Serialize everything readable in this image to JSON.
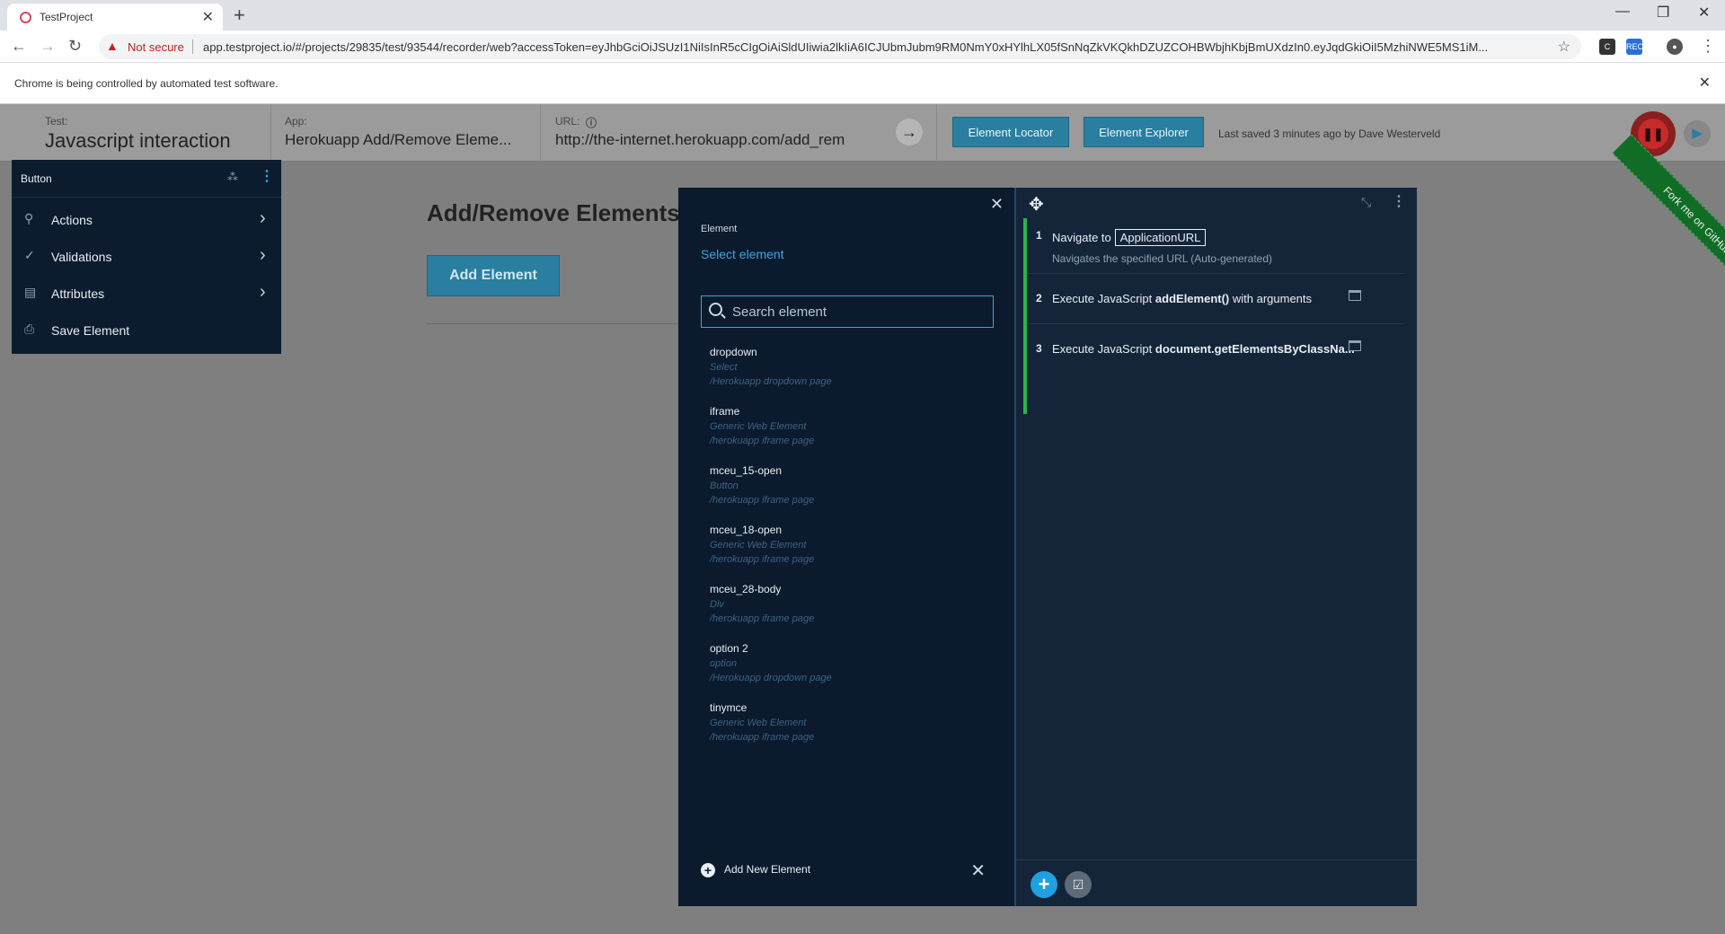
{
  "browser": {
    "tab_title": "TestProject",
    "new_tab": "+",
    "not_secure": "Not secure",
    "url": "app.testproject.io/#/projects/29835/test/93544/recorder/web?accessToken=eyJhbGciOiJSUzI1NiIsInR5cCIgOiAiSldUIiwia2lkIiA6ICJUbmJubm9RM0NmY0xHYlhLX05fSnNqZkVKQkhDZUZCOHBWbjhKbjBmUXdzIn0.eyJqdGkiOiI5MzhiNWE5MS1iM...",
    "automation_msg": "Chrome is being controlled by automated test software."
  },
  "header": {
    "test_label": "Test:",
    "test_value": "Javascript interaction",
    "app_label": "App:",
    "app_value": "Herokuapp Add/Remove Eleme...",
    "url_label": "URL:",
    "url_value": "http://the-internet.herokuapp.com/add_rem",
    "element_locator": "Element Locator",
    "element_explorer": "Element Explorer",
    "last_saved": "Last saved 3 minutes ago by Dave Westerveld"
  },
  "page": {
    "heading": "Add/Remove Elements",
    "add_button": "Add Element",
    "ribbon": "Fork me on GitHub"
  },
  "popover": {
    "title": "Button",
    "items": [
      {
        "label": "Actions"
      },
      {
        "label": "Validations"
      },
      {
        "label": "Attributes"
      },
      {
        "label": "Save Element"
      }
    ]
  },
  "picker": {
    "element_label": "Element",
    "select_element": "Select element",
    "search_placeholder": "Search element",
    "elements": [
      {
        "name": "dropdown",
        "type": "Select",
        "page": "/Herokuapp dropdown page"
      },
      {
        "name": "iframe",
        "type": "Generic Web Element",
        "page": "/herokuapp iframe page"
      },
      {
        "name": "mceu_15-open",
        "type": "Button",
        "page": "/herokuapp iframe page"
      },
      {
        "name": "mceu_18-open",
        "type": "Generic Web Element",
        "page": "/herokuapp iframe page"
      },
      {
        "name": "mceu_28-body",
        "type": "Div",
        "page": "/herokuapp iframe page"
      },
      {
        "name": "option 2",
        "type": "option",
        "page": "/Herokuapp dropdown page"
      },
      {
        "name": "tinymce",
        "type": "Generic Web Element",
        "page": "/herokuapp iframe page"
      }
    ],
    "add_new": "Add New Element"
  },
  "steps": {
    "items": [
      {
        "num": "1",
        "prefix": "Navigate to",
        "param": "ApplicationURL",
        "desc": "Navigates the specified URL (Auto-generated)"
      },
      {
        "num": "2",
        "prefix": "Execute JavaScript",
        "bold": "addElement()",
        "suffix": "with arguments"
      },
      {
        "num": "3",
        "prefix": "Execute JavaScript",
        "bold": "document.getElementsByClassNa..."
      }
    ]
  }
}
